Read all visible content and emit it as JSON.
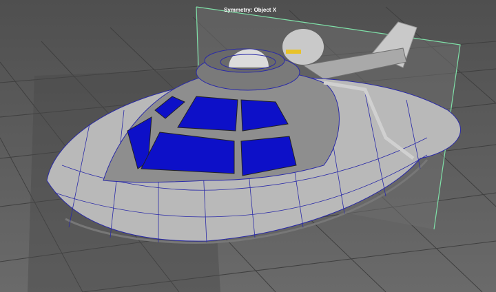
{
  "viewport": {
    "symmetry_label": "Symmetry: Object X"
  },
  "colors": {
    "background": "#5b5b5b",
    "grid_line": "#3e3e3e",
    "symmetry_plane_border": "#7fe0a8",
    "wireframe": "#2a2aa8",
    "hull": "#b9b9b9",
    "hull_dark": "#8e8e8e",
    "window_glass": "#0d10c8",
    "dome": "#d6d6d6",
    "highlight": "#e8c229"
  }
}
